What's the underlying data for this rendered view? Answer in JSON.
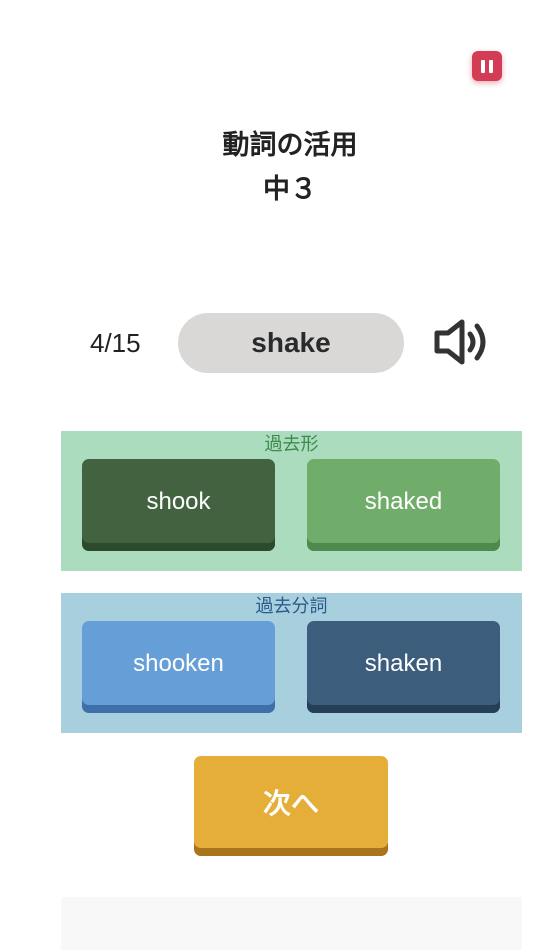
{
  "header": {
    "title_line1": "動詞の活用",
    "title_line2": "中３",
    "pause_icon": "pause-icon",
    "pause_color": "#d23c55"
  },
  "question": {
    "counter": "4/15",
    "word": "shake",
    "speaker_icon": "speaker-volume-icon"
  },
  "groups": {
    "past": {
      "label": "過去形",
      "choices": [
        "shook",
        "shaked"
      ],
      "colors": [
        "#436340",
        "#70ad6b"
      ]
    },
    "past_participle": {
      "label": "過去分詞",
      "choices": [
        "shooken",
        "shaken"
      ],
      "colors": [
        "#669fd8",
        "#3d5d7d"
      ]
    }
  },
  "next_button": {
    "label": "次へ",
    "color": "#e5ae38"
  }
}
